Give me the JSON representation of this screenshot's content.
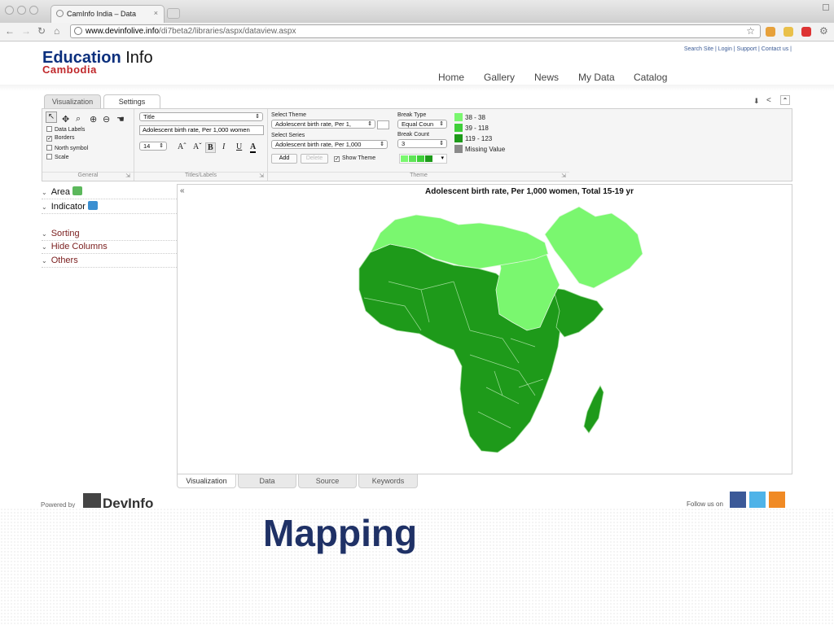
{
  "browser": {
    "tab_title": "CamInfo India – Data",
    "url_domain": "www.devinfolive.info",
    "url_path": "/di7beta2/libraries/aspx/dataview.aspx"
  },
  "site": {
    "logo_main": "Education",
    "logo_info": "Info",
    "logo_sub": "Cambodia",
    "top_links": "Search Site | Login | Support | Contact us |",
    "nav": [
      "Home",
      "Gallery",
      "News",
      "My Data",
      "Catalog"
    ]
  },
  "ribbon": {
    "tabs": [
      "Visualization",
      "Settings"
    ],
    "general": {
      "options": [
        {
          "label": "Data Labels",
          "checked": false
        },
        {
          "label": "Borders",
          "checked": true
        },
        {
          "label": "North symbol",
          "checked": false
        },
        {
          "label": "Scale",
          "checked": false
        }
      ],
      "footer": "General"
    },
    "titles": {
      "select": "Title",
      "text_value": "Adolescent birth rate, Per 1,000 women",
      "font_size": "14",
      "format_glyphs": [
        "Aˆ",
        "Aˇ",
        "B",
        "I",
        "U",
        "A"
      ],
      "footer": "Titles/Labels"
    },
    "theme": {
      "select_theme_label": "Select Theme",
      "select_theme_value": "Adolescent birth rate, Per 1,",
      "select_series_label": "Select Series",
      "select_series_value": "Adolescent birth rate, Per 1,000",
      "add_label": "Add",
      "delete_label": "Delete",
      "show_theme_label": "Show Theme",
      "show_theme_checked": true,
      "break_type_label": "Break Type",
      "break_type_value": "Equal Coun",
      "break_count_label": "Break Count",
      "break_count_value": "3",
      "footer": "Theme"
    },
    "legend": [
      {
        "label": "38 - 38",
        "color": "#7af76f"
      },
      {
        "label": "39 - 118",
        "color": "#3fcf39"
      },
      {
        "label": "119 - 123",
        "color": "#1e9a1a"
      },
      {
        "label": "Missing Value",
        "color": "#8a8a8a"
      }
    ]
  },
  "left_panel": {
    "items": [
      "Area",
      "Indicator",
      "Sorting",
      "Hide Columns",
      "Others"
    ]
  },
  "map": {
    "collapse": "«",
    "title": "Adolescent birth rate, Per 1,000 women, Total 15-19 yr"
  },
  "bottom_tabs": [
    "Visualization",
    "Data",
    "Source",
    "Keywords"
  ],
  "footer": {
    "powered_by": "Powered by",
    "brand": "DevInfo",
    "follow": "Follow us on"
  },
  "caption": "Mapping"
}
